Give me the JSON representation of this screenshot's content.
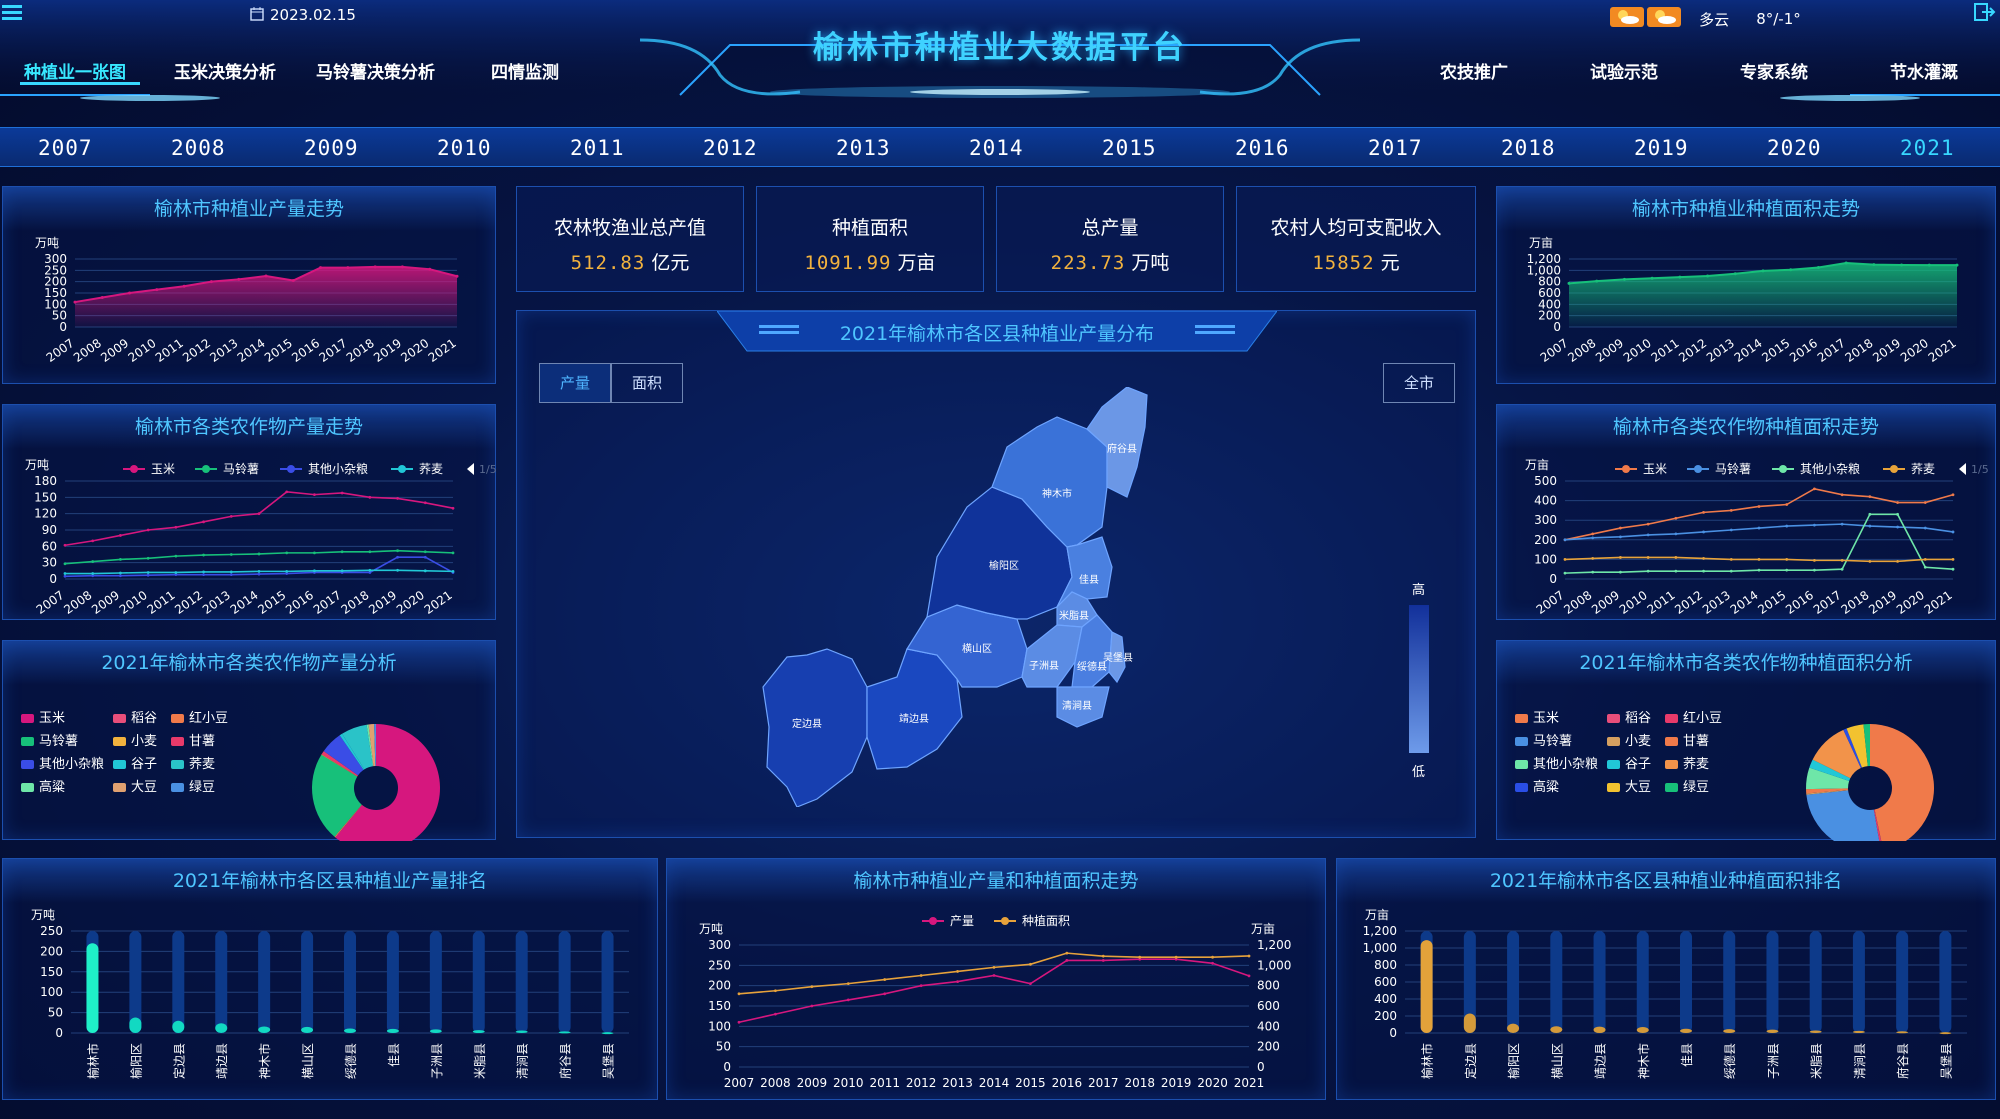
{
  "header": {
    "title": "榆林市种植业大数据平台",
    "date": "2023.02.15",
    "weather_text": "多云",
    "temperature": "8°/-1°",
    "nav_left": [
      "种植业一张图",
      "玉米决策分析",
      "马铃薯决策分析",
      "四情监测"
    ],
    "nav_right": [
      "农技推广",
      "试验示范",
      "专家系统",
      "节水灌溉"
    ],
    "active_nav": "种植业一张图",
    "menu_icon": "menu-icon",
    "exit_icon": "exit-icon",
    "calendar_icon": "calendar-icon",
    "weather_icon": "partly-cloudy-icon"
  },
  "years": [
    "2007",
    "2008",
    "2009",
    "2010",
    "2011",
    "2012",
    "2013",
    "2014",
    "2015",
    "2016",
    "2017",
    "2018",
    "2019",
    "2020",
    "2021"
  ],
  "active_year": "2021",
  "kpis": [
    {
      "label": "农林牧渔业总产值",
      "value": "512.83",
      "unit": "亿元"
    },
    {
      "label": "种植面积",
      "value": "1091.99",
      "unit": "万亩"
    },
    {
      "label": "总产量",
      "value": "223.73",
      "unit": "万吨"
    },
    {
      "label": "农村人均可支配收入",
      "value": "15852",
      "unit": "元"
    }
  ],
  "map": {
    "title": "2021年榆林市各区县种植业产量分布",
    "toggle": [
      "产量",
      "面积"
    ],
    "active_toggle": "产量",
    "scope_button": "全市",
    "scale_high": "高",
    "scale_low": "低",
    "districts": [
      "府谷县",
      "神木市",
      "榆阳区",
      "佳县",
      "米脂县",
      "横山区",
      "靖边县",
      "子洲县",
      "绥德县",
      "吴堡县",
      "定边县",
      "清涧县"
    ]
  },
  "panels": {
    "yield_trend": {
      "title": "榆林市种植业产量走势",
      "unit": "万吨"
    },
    "area_trend": {
      "title": "榆林市种植业种植面积走势",
      "unit": "万亩"
    },
    "crop_yield_trend": {
      "title": "榆林市各类农作物产量走势",
      "unit": "万吨",
      "page": "1/5"
    },
    "crop_area_trend": {
      "title": "榆林市各类农作物种植面积走势",
      "unit": "万亩",
      "page": "1/5"
    },
    "crop_yield_analysis": {
      "title": "2021年榆林市各类农作物产量分析"
    },
    "crop_area_analysis": {
      "title": "2021年榆林市各类农作物种植面积分析"
    },
    "district_yield_rank": {
      "title": "2021年榆林市各区县种植业产量排名",
      "unit": "万吨"
    },
    "yield_area_combo": {
      "title": "榆林市种植业产量和种植面积走势",
      "unit_left": "万吨",
      "unit_right": "万亩"
    },
    "district_area_rank": {
      "title": "2021年榆林市各区县种植业种植面积排名",
      "unit": "万亩"
    }
  },
  "colors": {
    "accent": "#38d8ff",
    "kpi_number": "#f2b23e",
    "yield_line": "#d6177e",
    "area_line": "#17c07a",
    "combo_area": "#e7a23b"
  },
  "chart_data": [
    {
      "id": "yield_trend",
      "type": "area",
      "x": [
        "2007",
        "2008",
        "2009",
        "2010",
        "2011",
        "2012",
        "2013",
        "2014",
        "2015",
        "2016",
        "2017",
        "2018",
        "2019",
        "2020",
        "2021"
      ],
      "series": [
        {
          "values": [
            110,
            130,
            150,
            165,
            180,
            200,
            210,
            225,
            205,
            262,
            262,
            265,
            265,
            255,
            224
          ]
        }
      ],
      "ylim": [
        0,
        300
      ],
      "yticks": [
        0,
        50,
        100,
        150,
        200,
        250,
        300
      ],
      "ylabel": "万吨"
    },
    {
      "id": "area_trend",
      "type": "area",
      "x": [
        "2007",
        "2008",
        "2009",
        "2010",
        "2011",
        "2012",
        "2013",
        "2014",
        "2015",
        "2016",
        "2017",
        "2018",
        "2019",
        "2020",
        "2021"
      ],
      "series": [
        {
          "values": [
            770,
            810,
            840,
            860,
            880,
            900,
            940,
            990,
            1010,
            1050,
            1130,
            1100,
            1095,
            1092,
            1092
          ]
        }
      ],
      "ylim": [
        0,
        1200
      ],
      "yticks": [
        0,
        200,
        400,
        600,
        800,
        1000,
        1200
      ],
      "ylabel": "万亩"
    },
    {
      "id": "crop_yield_trend",
      "type": "line",
      "x": [
        "2007",
        "2008",
        "2009",
        "2010",
        "2011",
        "2012",
        "2013",
        "2014",
        "2015",
        "2016",
        "2017",
        "2018",
        "2019",
        "2020",
        "2021"
      ],
      "legend": [
        "玉米",
        "马铃薯",
        "其他小杂粮",
        "荞麦"
      ],
      "series": [
        {
          "name": "玉米",
          "color": "#d6177e",
          "values": [
            62,
            70,
            80,
            90,
            95,
            105,
            115,
            120,
            160,
            155,
            158,
            150,
            148,
            140,
            130
          ]
        },
        {
          "name": "马铃薯",
          "color": "#17c07a",
          "values": [
            28,
            32,
            36,
            38,
            42,
            44,
            45,
            46,
            48,
            48,
            50,
            50,
            52,
            50,
            48
          ]
        },
        {
          "name": "其他小杂粮",
          "color": "#3a4de6",
          "values": [
            5,
            6,
            6,
            7,
            8,
            8,
            8,
            9,
            10,
            12,
            12,
            12,
            40,
            40,
            12
          ]
        },
        {
          "name": "荞麦",
          "color": "#21c7d6",
          "values": [
            10,
            10,
            11,
            12,
            12,
            13,
            13,
            14,
            14,
            15,
            15,
            16,
            16,
            15,
            14
          ]
        }
      ],
      "ylim": [
        0,
        180
      ],
      "yticks": [
        0,
        30,
        60,
        90,
        120,
        150,
        180
      ],
      "ylabel": "万吨"
    },
    {
      "id": "crop_area_trend",
      "type": "line",
      "x": [
        "2007",
        "2008",
        "2009",
        "2010",
        "2011",
        "2012",
        "2013",
        "2014",
        "2015",
        "2016",
        "2017",
        "2018",
        "2019",
        "2020",
        "2021"
      ],
      "legend": [
        "玉米",
        "马铃薯",
        "其他小杂粮",
        "荞麦"
      ],
      "series": [
        {
          "name": "玉米",
          "color": "#f07a4a",
          "values": [
            200,
            230,
            260,
            280,
            310,
            340,
            350,
            370,
            380,
            460,
            430,
            420,
            390,
            390,
            430
          ]
        },
        {
          "name": "马铃薯",
          "color": "#4a90e2",
          "values": [
            200,
            210,
            215,
            225,
            230,
            240,
            250,
            260,
            270,
            275,
            280,
            270,
            265,
            260,
            240
          ]
        },
        {
          "name": "其他小杂粮",
          "color": "#6ee6a8",
          "values": [
            30,
            35,
            35,
            40,
            40,
            40,
            40,
            45,
            45,
            45,
            50,
            330,
            330,
            60,
            50
          ]
        },
        {
          "name": "荞麦",
          "color": "#e8a33a",
          "values": [
            100,
            105,
            110,
            110,
            110,
            105,
            100,
            100,
            100,
            95,
            95,
            90,
            90,
            100,
            100
          ]
        }
      ],
      "ylim": [
        0,
        500
      ],
      "yticks": [
        0,
        100,
        200,
        300,
        400,
        500
      ],
      "ylabel": "万亩"
    },
    {
      "id": "crop_yield_analysis",
      "type": "pie",
      "legend": [
        "玉米",
        "稻谷",
        "红小豆",
        "马铃薯",
        "小麦",
        "甘薯",
        "其他小杂粮",
        "谷子",
        "荞麦",
        "高粱",
        "大豆",
        "绿豆"
      ],
      "colors": [
        "#d6177e",
        "#e84e7a",
        "#f07a4a",
        "#17c07a",
        "#f2b23e",
        "#e83a6a",
        "#3a4de6",
        "#21c7d6",
        "#2ac3c8",
        "#6ee6a8",
        "#e0a070",
        "#4a90e2"
      ],
      "values": [
        130,
        0.2,
        0.5,
        48,
        0.3,
        2,
        12,
        1.5,
        14,
        1,
        3,
        1
      ]
    },
    {
      "id": "crop_area_analysis",
      "type": "pie",
      "legend": [
        "玉米",
        "稻谷",
        "红小豆",
        "马铃薯",
        "小麦",
        "甘薯",
        "其他小杂粮",
        "谷子",
        "荞麦",
        "高粱",
        "大豆",
        "绿豆"
      ],
      "colors": [
        "#f07a4a",
        "#e84e7a",
        "#e83a6a",
        "#4a90e2",
        "#d6a060",
        "#f07a4a",
        "#6ee6a8",
        "#21c7d6",
        "#f2934a",
        "#2a4ee6",
        "#f2c230",
        "#17c07a"
      ],
      "values": [
        430,
        0.5,
        5,
        240,
        3,
        10,
        50,
        20,
        100,
        8,
        40,
        15
      ]
    },
    {
      "id": "district_yield_rank",
      "type": "bar",
      "categories": [
        "榆林市",
        "榆阳区",
        "定边县",
        "靖边县",
        "神木市",
        "横山区",
        "绥德县",
        "佳县",
        "子洲县",
        "米脂县",
        "清涧县",
        "府谷县",
        "吴堡县"
      ],
      "values": [
        220,
        38,
        30,
        24,
        16,
        15,
        11,
        10,
        9,
        7,
        6,
        4,
        2
      ],
      "ylim": [
        0,
        250
      ],
      "yticks": [
        0,
        50,
        100,
        150,
        200,
        250
      ],
      "ylabel": "万吨"
    },
    {
      "id": "yield_area_combo",
      "type": "line",
      "x": [
        "2007",
        "2008",
        "2009",
        "2010",
        "2011",
        "2012",
        "2013",
        "2014",
        "2015",
        "2016",
        "2017",
        "2018",
        "2019",
        "2020",
        "2021"
      ],
      "legend": [
        "产量",
        "种植面积"
      ],
      "series": [
        {
          "name": "产量",
          "axis": "left",
          "color": "#d6177e",
          "values": [
            110,
            130,
            150,
            165,
            180,
            200,
            210,
            225,
            205,
            262,
            262,
            265,
            265,
            255,
            224
          ]
        },
        {
          "name": "种植面积",
          "axis": "right",
          "color": "#e7a23b",
          "values": [
            720,
            750,
            790,
            820,
            860,
            900,
            940,
            980,
            1010,
            1120,
            1090,
            1080,
            1080,
            1080,
            1092
          ]
        }
      ],
      "ylim": [
        0,
        300
      ],
      "yticks": [
        0,
        50,
        100,
        150,
        200,
        250,
        300
      ],
      "y2lim": [
        0,
        1200
      ],
      "y2ticks": [
        0,
        200,
        400,
        600,
        800,
        1000,
        1200
      ],
      "ylabel": "万吨",
      "y2label": "万亩"
    },
    {
      "id": "district_area_rank",
      "type": "bar",
      "categories": [
        "榆林市",
        "定边县",
        "榆阳区",
        "横山区",
        "靖边县",
        "神木市",
        "佳县",
        "绥德县",
        "子洲县",
        "米脂县",
        "清涧县",
        "府谷县",
        "吴堡县"
      ],
      "values": [
        1092,
        230,
        110,
        80,
        75,
        70,
        50,
        45,
        40,
        30,
        25,
        20,
        10
      ],
      "ylim": [
        0,
        1200
      ],
      "yticks": [
        0,
        200,
        400,
        600,
        800,
        1000,
        1200
      ],
      "ylabel": "万亩"
    }
  ]
}
